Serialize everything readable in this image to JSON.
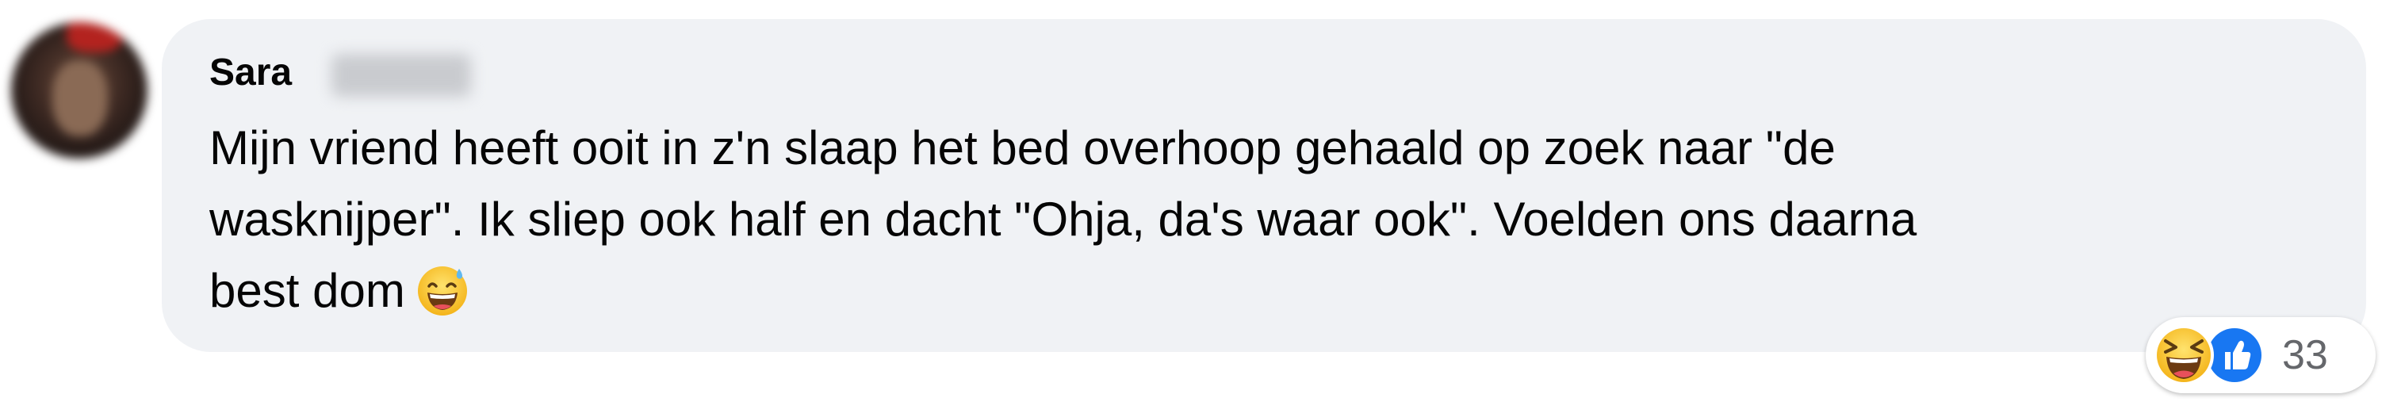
{
  "comment": {
    "author_first_name": "Sara",
    "text_lines": [
      "Mijn vriend heeft ooit in z'n slaap het bed overhoop gehaald op zoek naar \"de",
      "wasknijper\". Ik sliep ook half en dacht \"Ohja, da's waar ook\". Voelden ons daarna",
      "best dom"
    ],
    "inline_emoji": "grinning-sweat-emoji"
  },
  "reactions": {
    "types": [
      "haha",
      "like"
    ],
    "count": "33"
  },
  "colors": {
    "bubble_bg": "#f0f2f5",
    "text": "#050505",
    "secondary_text": "#65676b",
    "like_blue": "#1877f2",
    "emoji_yellow": "#f7c12b"
  }
}
